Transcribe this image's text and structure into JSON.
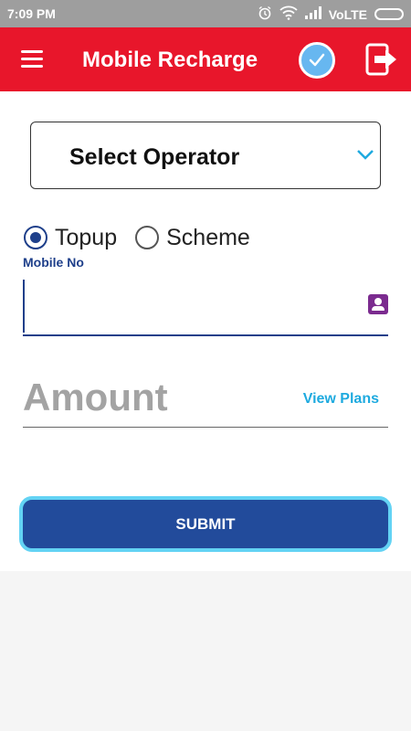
{
  "status_bar": {
    "time": "7:09 PM",
    "network": "VoLTE",
    "icons": [
      "alarm-icon",
      "wifi-icon",
      "signal-icon",
      "battery-icon"
    ]
  },
  "app_bar": {
    "title": "Mobile Recharge",
    "icons": [
      "menu-icon",
      "check-icon",
      "logout-icon"
    ],
    "color": "#e8162b"
  },
  "form": {
    "operator_label": "Select Operator",
    "radio_options": [
      {
        "label": "Topup",
        "selected": true
      },
      {
        "label": "Scheme",
        "selected": false
      }
    ],
    "mobile_label": "Mobile No",
    "mobile_value": "",
    "amount_placeholder": "Amount",
    "view_plans_label": "View Plans",
    "submit_label": "SUBMIT"
  },
  "colors": {
    "accent_blue": "#1e3f8a",
    "link_blue": "#1eaadf",
    "submit_bg": "#224b9b",
    "submit_border": "#63d3f4"
  }
}
